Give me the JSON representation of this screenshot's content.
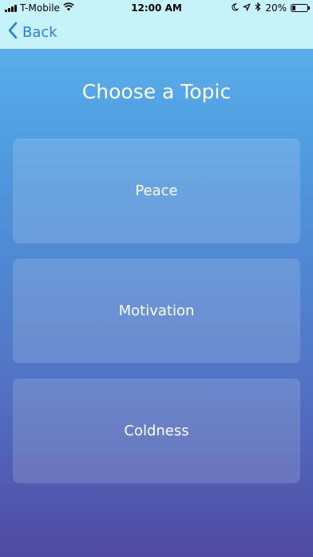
{
  "status_bar": {
    "carrier": "T-Mobile",
    "time": "12:00 AM",
    "battery_percent": "20%",
    "battery_level": 0.2
  },
  "nav": {
    "back_label": "Back",
    "accent_color": "#2c7be5"
  },
  "page": {
    "title": "Choose a Topic"
  },
  "topics": [
    {
      "label": "Peace"
    },
    {
      "label": "Motivation"
    },
    {
      "label": "Coldness"
    }
  ],
  "colors": {
    "header_bg": "#c6f3f9",
    "gradient_top": "#5cb8f0",
    "gradient_bottom": "#4f4aa2"
  }
}
